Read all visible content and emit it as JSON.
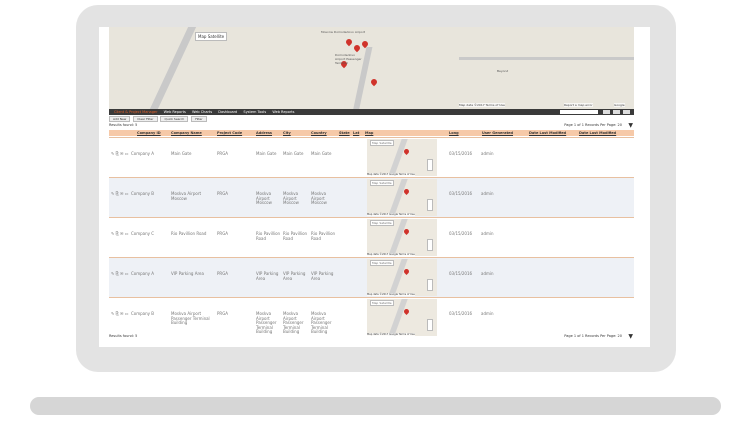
{
  "top_map": {
    "map_label": "Map",
    "satellite_label": "Satellite",
    "place_label_1": "Moscow Domodedovo Airport",
    "place_label_2": "Domodedovo Airport Passenger Terminal",
    "place_label_3": "Beyond",
    "attribution": "Map data ©2017  Terms of Use",
    "report_error": "Report a map error",
    "google": "Google"
  },
  "navbar": {
    "items": [
      "Client & Project Manager",
      "Web Reports",
      "Web Charts",
      "Dashboard",
      "System Tools",
      "Web Reports"
    ],
    "search_placeholder": "search"
  },
  "tabs": [
    "Add New",
    "Clear Filter",
    "Quick Search",
    "Filter"
  ],
  "results": {
    "found_label": "Results found: 5",
    "pager_label": "Page 1 of 1  Records Per Page:  20",
    "arrow": "▼"
  },
  "table": {
    "headers": [
      "Company ID",
      "Company Name",
      "Project Code",
      "Address",
      "City",
      "Country",
      "State",
      "Lat",
      "Map",
      "Long",
      "User Generated",
      "Date Last Modified",
      "Date Last Modified"
    ],
    "rows": [
      {
        "icons": "✎ ⎘ ✉ ▭",
        "company": "Company A",
        "name": "Main Gate",
        "code": "PRGA",
        "address": "Main Gate",
        "city": "Main Gate",
        "country": "Main Gate",
        "date": "03/15/2016",
        "user": "admin"
      },
      {
        "icons": "✎ ⎘ ✉ ▭",
        "company": "Company B",
        "name": "Moskva Airport Moscow",
        "code": "PRGA",
        "address": "Moskva Airport Moscow",
        "city": "Moskva Airport Moscow",
        "country": "Moskva Airport Moscow",
        "date": "03/15/2016",
        "user": "admin"
      },
      {
        "icons": "✎ ⎘ ✉ ▭",
        "company": "Company C",
        "name": "Rio Pavillion Road",
        "code": "PRGA",
        "address": "Rio Pavillion Road",
        "city": "Rio Pavillion Road",
        "country": "Rio Pavillion Road",
        "date": "03/15/2016",
        "user": "admin"
      },
      {
        "icons": "✎ ⎘ ✉ ▭",
        "company": "Company A",
        "name": "VIP Parking Area",
        "code": "PRGA",
        "address": "VIP Parking Area",
        "city": "VIP Parking Area",
        "country": "VIP Parking Area",
        "date": "03/15/2016",
        "user": "admin"
      },
      {
        "icons": "✎ ⎘ ✉ ▭",
        "company": "Company B",
        "name": "Moskva Airport Passenger Terminal Building",
        "code": "PRGA",
        "address": "Moskva Airport Passenger Terminal Building",
        "city": "Moskva Airport Passenger Terminal Building",
        "country": "Moskva Airport Passenger Terminal Building",
        "date": "03/15/2016",
        "user": "admin"
      }
    ],
    "minimap": {
      "map_label": "Map",
      "satellite_label": "Satellite",
      "attribution": "Map data ©2017 Google  Terms of Use"
    }
  },
  "colors": {
    "header_bg": "#f6c9a8",
    "nav_bg": "#3a3a3a",
    "accent": "#e6612c",
    "pin": "#d0332b"
  }
}
